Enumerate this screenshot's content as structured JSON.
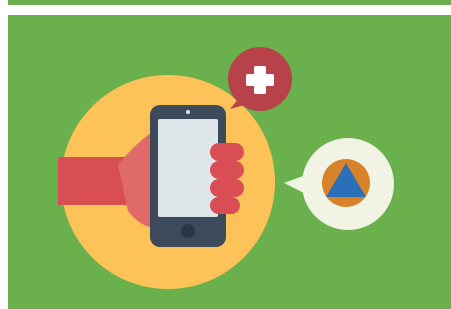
{
  "colors": {
    "green": "#6ab04c",
    "yellow_circle": "#fdc358",
    "hand_red": "#e06a6a",
    "sleeve_red": "#d94e55",
    "phone_dark": "#3d4a5c",
    "phone_screen": "#dfe6e9",
    "bubble_red": "#b7424a",
    "bubble_cream": "#f1f4e4",
    "orange": "#d8822a",
    "blue": "#2a6fb8",
    "white": "#ffffff"
  },
  "icons": {
    "medical": "plus-icon",
    "civil_protection": "triangle-in-circle-icon"
  }
}
